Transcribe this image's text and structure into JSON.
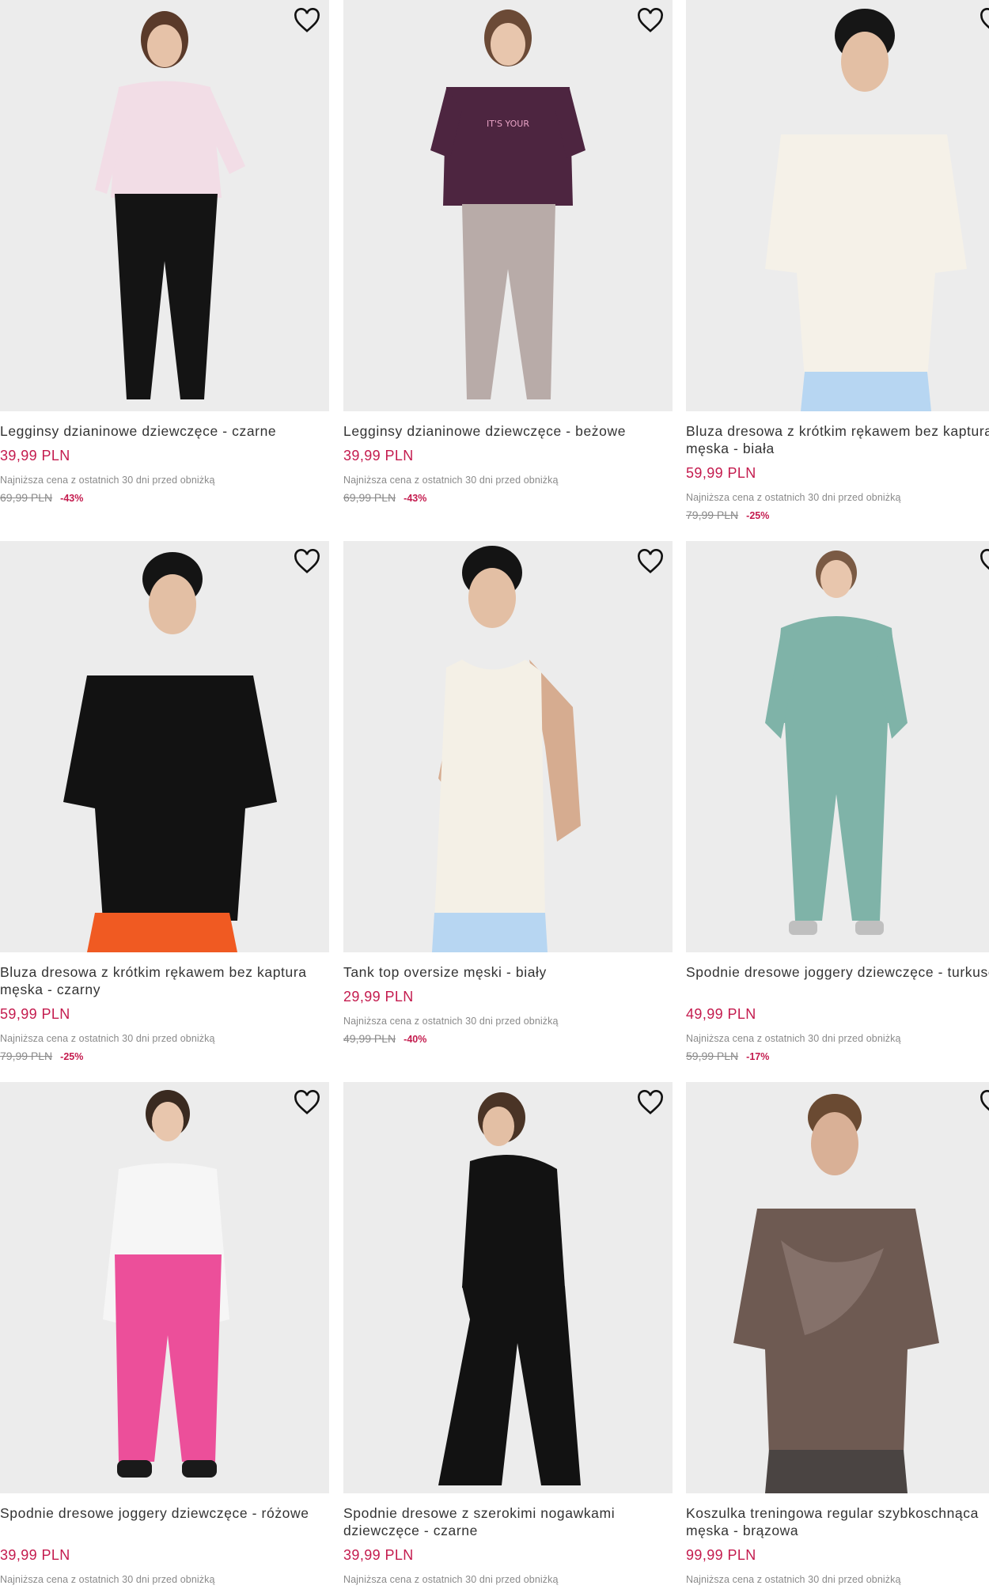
{
  "colors": {
    "accent": "#c41b4e",
    "muted": "#8a8a8a",
    "image_bg": "#ececec"
  },
  "products": [
    {
      "title": "Legginsy dzianinowe dziewczęce - czarne",
      "price": "39,99 PLN",
      "lowest_label": "Najniższa cena z ostatnich 30 dni przed obniżką",
      "old_price": "69,99 PLN",
      "discount": "-43%",
      "favorite_icon": "heart-outline-icon"
    },
    {
      "title": "Legginsy dzianinowe dziewczęce - beżowe",
      "price": "39,99 PLN",
      "lowest_label": "Najniższa cena z ostatnich 30 dni przed obniżką",
      "old_price": "69,99 PLN",
      "discount": "-43%",
      "favorite_icon": "heart-outline-icon"
    },
    {
      "title": "Bluza dresowa z krótkim rękawem bez kaptura męska - biała",
      "price": "59,99 PLN",
      "lowest_label": "Najniższa cena z ostatnich 30 dni przed obniżką",
      "old_price": "79,99 PLN",
      "discount": "-25%",
      "favorite_icon": "heart-outline-icon"
    },
    {
      "title": "Bluza dresowa z krótkim rękawem bez kaptura męska - czarny",
      "price": "59,99 PLN",
      "lowest_label": "Najniższa cena z ostatnich 30 dni przed obniżką",
      "old_price": "79,99 PLN",
      "discount": "-25%",
      "favorite_icon": "heart-outline-icon"
    },
    {
      "title": "Tank top oversize męski - biały",
      "price": "29,99 PLN",
      "lowest_label": "Najniższa cena z ostatnich 30 dni przed obniżką",
      "old_price": "49,99 PLN",
      "discount": "-40%",
      "favorite_icon": "heart-outline-icon"
    },
    {
      "title": "Spodnie dresowe joggery dziewczęce - turkusowe",
      "price": "49,99 PLN",
      "lowest_label": "Najniższa cena z ostatnich 30 dni przed obniżką",
      "old_price": "59,99 PLN",
      "discount": "-17%",
      "favorite_icon": "heart-outline-icon"
    },
    {
      "title": "Spodnie dresowe joggery dziewczęce - różowe",
      "price": "39,99 PLN",
      "lowest_label": "Najniższa cena z ostatnich 30 dni przed obniżką",
      "old_price": "",
      "discount": "",
      "favorite_icon": "heart-outline-icon"
    },
    {
      "title": "Spodnie dresowe z szerokimi nogawkami dziewczęce - czarne",
      "price": "39,99 PLN",
      "lowest_label": "Najniższa cena z ostatnich 30 dni przed obniżką",
      "old_price": "",
      "discount": "",
      "favorite_icon": "heart-outline-icon"
    },
    {
      "title": "Koszulka treningowa regular szybkoschnąca męska - brązowa",
      "price": "99,99 PLN",
      "lowest_label": "Najniższa cena z ostatnich 30 dni przed obniżką",
      "old_price": "",
      "discount": "",
      "favorite_icon": "heart-outline-icon"
    }
  ]
}
